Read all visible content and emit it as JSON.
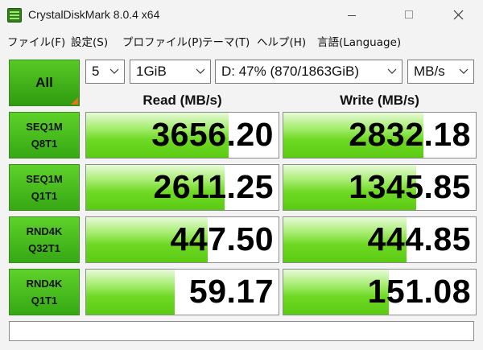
{
  "window": {
    "title": "CrystalDiskMark 8.0.4 x64",
    "icon": "crystaldiskmark-app-icon"
  },
  "menu": {
    "items": [
      "ファイル(F)",
      "設定(S)",
      "プロファイル(P)",
      "テーマ(T)",
      "ヘルプ(H)",
      "言語(Language)"
    ]
  },
  "controls": {
    "all_label": "All",
    "count": "5",
    "size": "1GiB",
    "drive": "D: 47% (870/1863GiB)",
    "unit": "MB/s"
  },
  "headers": {
    "read": "Read (MB/s)",
    "write": "Write (MB/s)"
  },
  "rows": [
    {
      "line1": "SEQ1M",
      "line2": "Q8T1",
      "read": "3656.20",
      "write": "2832.18",
      "read_fill": 0.74,
      "write_fill": 0.73
    },
    {
      "line1": "SEQ1M",
      "line2": "Q1T1",
      "read": "2611.25",
      "write": "1345.85",
      "read_fill": 0.72,
      "write_fill": 0.69
    },
    {
      "line1": "RND4K",
      "line2": "Q32T1",
      "read": "447.50",
      "write": "444.85",
      "read_fill": 0.63,
      "write_fill": 0.64
    },
    {
      "line1": "RND4K",
      "line2": "Q1T1",
      "read": "59.17",
      "write": "151.08",
      "read_fill": 0.46,
      "write_fill": 0.55
    }
  ],
  "colors": {
    "accent_green": "#4cbe1c",
    "corner_orange": "#e8731c"
  },
  "comment": ""
}
